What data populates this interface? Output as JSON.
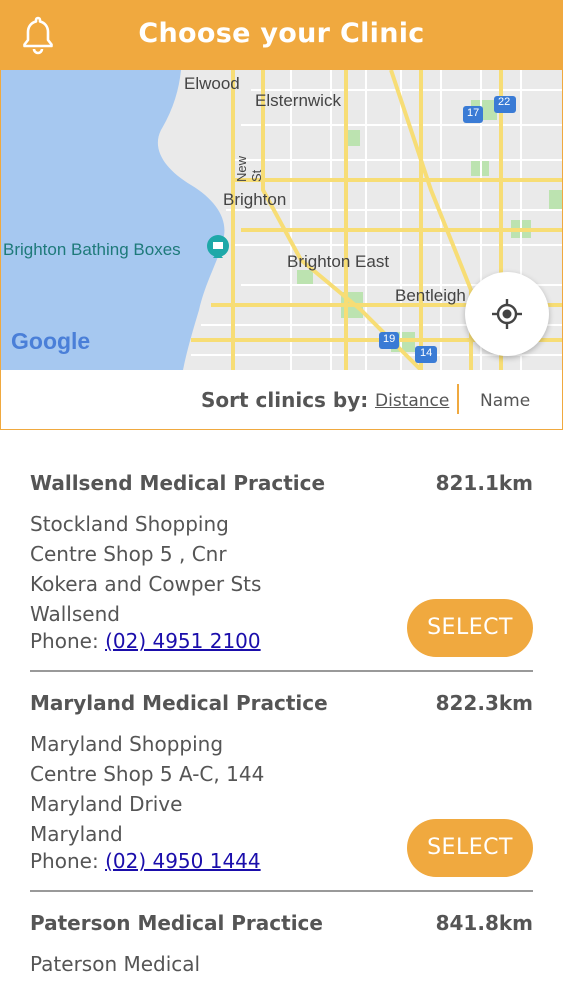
{
  "header": {
    "title": "Choose your Clinic",
    "color": "#F0A93F"
  },
  "map": {
    "labels": {
      "elwood": "Elwood",
      "elsternwick": "Elsternwick",
      "new_st": "New St",
      "brighton": "Brighton",
      "bathing_boxes": "Brighton Bathing Boxes",
      "brighton_east": "Brighton East",
      "bentleigh": "Bentleigh",
      "google": "Google"
    },
    "route_shields": [
      "17",
      "22",
      "19",
      "14"
    ]
  },
  "sort": {
    "label": "Sort clinics by:",
    "options": [
      "Distance",
      "Name"
    ],
    "selected": "Distance"
  },
  "clinics": [
    {
      "name": "Wallsend Medical Practice",
      "distance": "821.1km",
      "address": "Stockland Shopping Centre Shop 5 , Cnr Kokera and Cowper Sts Wallsend",
      "phone_label": "Phone:",
      "phone": "(02) 4951 2100",
      "button": "SELECT"
    },
    {
      "name": "Maryland Medical Practice",
      "distance": "822.3km",
      "address": "Maryland Shopping Centre Shop 5 A-C, 144 Maryland Drive Maryland",
      "phone_label": "Phone:",
      "phone": "(02) 4950 1444",
      "button": "SELECT"
    },
    {
      "name": "Paterson Medical Practice",
      "distance": "841.8km",
      "address": "Paterson Medical"
    }
  ]
}
